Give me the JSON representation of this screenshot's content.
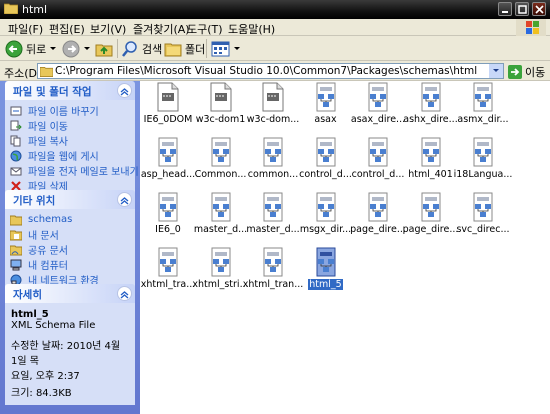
{
  "window": {
    "title": "html"
  },
  "menu": [
    "파일(F)",
    "편집(E)",
    "보기(V)",
    "즐겨찾기(A)",
    "도구(T)",
    "도움말(H)"
  ],
  "toolbar": {
    "back": "뒤로",
    "search": "검색",
    "folders": "폴더"
  },
  "address": {
    "label": "주소(D)",
    "path": "C:\\Program Files\\Microsoft Visual Studio 10.0\\Common7\\Packages\\schemas\\html",
    "go": "이동"
  },
  "tasks": {
    "file_header": "파일 및 폴더 작업",
    "file_items": [
      "파일 이름 바꾸기",
      "파일 이동",
      "파일 복사",
      "파일을 웹에 게시",
      "파일을 전자 메일로 보내기",
      "파일 삭제"
    ],
    "other_header": "기타 위치",
    "other_items": [
      "schemas",
      "내 문서",
      "공유 문서",
      "내 컴퓨터",
      "내 네트워크 환경"
    ],
    "details_header": "자세히",
    "details": {
      "name": "html_5",
      "type": "XML Schema File",
      "modified_label": "수정한 날짜: 2010년 4월 1일 목",
      "modified_time": "요일, 오후 2:37",
      "size": "크기: 84.3KB"
    }
  },
  "files": [
    {
      "name": "IE6_0DOM",
      "icon": "doc-icon"
    },
    {
      "name": "w3c-dom1",
      "icon": "doc-icon"
    },
    {
      "name": "w3c-dom...",
      "icon": "doc-icon"
    },
    {
      "name": "asax",
      "icon": "xsd-icon"
    },
    {
      "name": "asax_dire...",
      "icon": "xsd-icon"
    },
    {
      "name": "ashx_dire...",
      "icon": "xsd-icon"
    },
    {
      "name": "asmx_dir...",
      "icon": "xsd-icon"
    },
    {
      "name": "asp_head...",
      "icon": "xsd-icon"
    },
    {
      "name": "Common...",
      "icon": "xsd-icon"
    },
    {
      "name": "common...",
      "icon": "xsd-icon"
    },
    {
      "name": "control_d...",
      "icon": "xsd-icon"
    },
    {
      "name": "control_d...",
      "icon": "xsd-icon"
    },
    {
      "name": "html_401",
      "icon": "xsd-icon"
    },
    {
      "name": "i18Langua...",
      "icon": "xsd-icon"
    },
    {
      "name": "IE6_0",
      "icon": "xsd-icon"
    },
    {
      "name": "master_d...",
      "icon": "xsd-icon"
    },
    {
      "name": "master_d...",
      "icon": "xsd-icon"
    },
    {
      "name": "msgx_dir...",
      "icon": "xsd-icon"
    },
    {
      "name": "page_dire...",
      "icon": "xsd-icon"
    },
    {
      "name": "page_dire...",
      "icon": "xsd-icon"
    },
    {
      "name": "svc_direc...",
      "icon": "xsd-icon"
    },
    {
      "name": "xhtml_tra...",
      "icon": "xsd-icon"
    },
    {
      "name": "xhtml_stri...",
      "icon": "xsd-icon"
    },
    {
      "name": "xhtml_tran...",
      "icon": "xsd-icon"
    },
    {
      "name": "html_5",
      "icon": "xsd-icon",
      "selected": true
    }
  ],
  "colors": {
    "pane_blue": "#6d84d6",
    "link_blue": "#215dc6",
    "selection": "#316ac5"
  }
}
